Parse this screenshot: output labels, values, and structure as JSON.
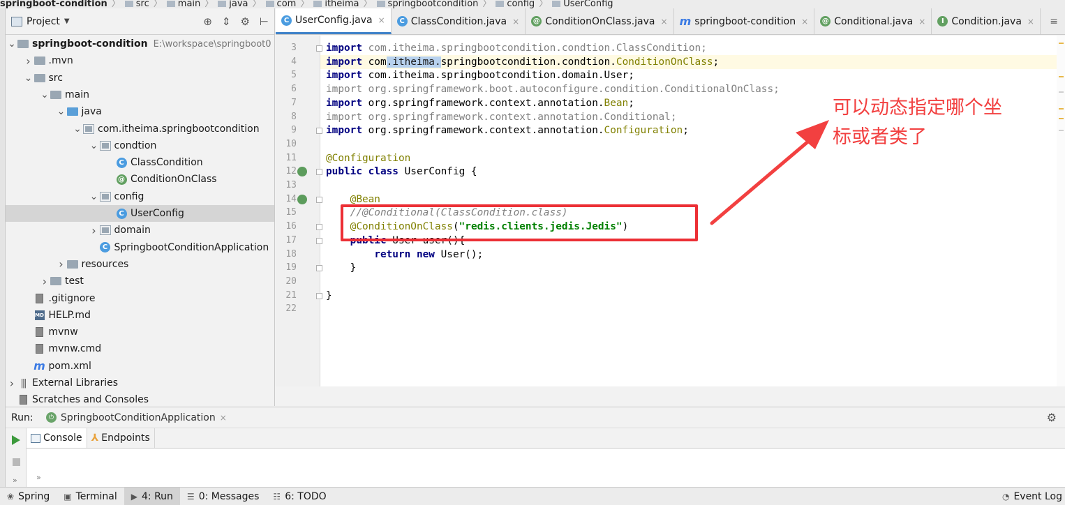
{
  "breadcrumb": [
    "springboot-condition",
    "src",
    "main",
    "java",
    "com",
    "itheima",
    "springbootcondition",
    "config",
    "UserConfig"
  ],
  "project_panel": {
    "title": "Project",
    "tree": [
      {
        "label": "springboot-condition",
        "path": "E:\\workspace\\springboot0",
        "level": 0,
        "expanded": true,
        "icon": "folder-icon",
        "bold": true
      },
      {
        "label": ".mvn",
        "level": 1,
        "expanded": false,
        "icon": "folder-icon"
      },
      {
        "label": "src",
        "level": 1,
        "expanded": true,
        "icon": "folder-icon"
      },
      {
        "label": "main",
        "level": 2,
        "expanded": true,
        "icon": "folder-icon"
      },
      {
        "label": "java",
        "level": 3,
        "expanded": true,
        "icon": "source-folder-icon"
      },
      {
        "label": "com.itheima.springbootcondition",
        "level": 4,
        "expanded": true,
        "icon": "package-icon"
      },
      {
        "label": "condtion",
        "level": 5,
        "expanded": true,
        "icon": "package-icon"
      },
      {
        "label": "ClassCondition",
        "level": 6,
        "icon": "class-icon"
      },
      {
        "label": "ConditionOnClass",
        "level": 6,
        "icon": "annotation-icon"
      },
      {
        "label": "config",
        "level": 5,
        "expanded": true,
        "icon": "package-icon"
      },
      {
        "label": "UserConfig",
        "level": 6,
        "icon": "class-icon",
        "selected": true
      },
      {
        "label": "domain",
        "level": 5,
        "expanded": false,
        "icon": "package-icon"
      },
      {
        "label": "SpringbootConditionApplication",
        "level": 5,
        "icon": "spring-boot-class-icon"
      },
      {
        "label": "resources",
        "level": 3,
        "expanded": false,
        "icon": "resources-folder-icon"
      },
      {
        "label": "test",
        "level": 2,
        "expanded": false,
        "icon": "folder-icon"
      },
      {
        "label": ".gitignore",
        "level": 1,
        "icon": "file-icon"
      },
      {
        "label": "HELP.md",
        "level": 1,
        "icon": "markdown-icon"
      },
      {
        "label": "mvnw",
        "level": 1,
        "icon": "file-icon"
      },
      {
        "label": "mvnw.cmd",
        "level": 1,
        "icon": "file-icon"
      },
      {
        "label": "pom.xml",
        "level": 1,
        "icon": "maven-icon"
      },
      {
        "label": "External Libraries",
        "level": 0,
        "expanded": false,
        "icon": "library-icon"
      },
      {
        "label": "Scratches and Consoles",
        "level": 0,
        "icon": "scratches-icon"
      }
    ]
  },
  "editor_tabs": [
    {
      "label": "UserConfig.java",
      "icon": "class-icon",
      "active": true
    },
    {
      "label": "ClassCondition.java",
      "icon": "class-icon"
    },
    {
      "label": "ConditionOnClass.java",
      "icon": "annotation-icon"
    },
    {
      "label": "springboot-condition",
      "icon": "maven-icon"
    },
    {
      "label": "Conditional.java",
      "icon": "annotation-icon"
    },
    {
      "label": "Condition.java",
      "icon": "interface-icon"
    }
  ],
  "code_lines": [
    {
      "n": "3",
      "tokens": [
        [
          "kw",
          "import"
        ],
        [
          "gray",
          " com.itheima.springbootcondition.condtion.ClassCondition;"
        ]
      ]
    },
    {
      "n": "4",
      "current": true,
      "tokens": [
        [
          "kw",
          "import"
        ],
        [
          "ident",
          " co"
        ],
        [
          "ident",
          "m"
        ],
        [
          "sel",
          ".itheima."
        ],
        [
          "ident",
          "springbootcondition.condtion."
        ],
        [
          "ann",
          "ConditionOnClass"
        ],
        [
          "ident",
          ";"
        ]
      ]
    },
    {
      "n": "5",
      "tokens": [
        [
          "kw",
          "import"
        ],
        [
          "ident",
          " com.itheima.springbootcondition.domain.User;"
        ]
      ]
    },
    {
      "n": "6",
      "tokens": [
        [
          "gray",
          "import org.springframework.boot.autoconfigure.condition.ConditionalOnClass;"
        ]
      ]
    },
    {
      "n": "7",
      "tokens": [
        [
          "kw",
          "import"
        ],
        [
          "ident",
          " org.springframework.context.annotation."
        ],
        [
          "ann",
          "Bean"
        ],
        [
          "ident",
          ";"
        ]
      ]
    },
    {
      "n": "8",
      "tokens": [
        [
          "gray",
          "import org.springframework.context.annotation.Conditional;"
        ]
      ]
    },
    {
      "n": "9",
      "tokens": [
        [
          "kw",
          "import"
        ],
        [
          "ident",
          " org.springframework.context.annotation."
        ],
        [
          "ann",
          "Configuration"
        ],
        [
          "ident",
          ";"
        ]
      ]
    },
    {
      "n": "10",
      "tokens": []
    },
    {
      "n": "11",
      "tokens": [
        [
          "ann",
          "@Configuration"
        ]
      ]
    },
    {
      "n": "12",
      "tokens": [
        [
          "kw",
          "public class"
        ],
        [
          "ident",
          " UserConfig {"
        ]
      ]
    },
    {
      "n": "13",
      "tokens": []
    },
    {
      "n": "14",
      "tokens": [
        [
          "ident",
          "    "
        ],
        [
          "ann",
          "@Bean"
        ]
      ]
    },
    {
      "n": "15",
      "tokens": [
        [
          "ident",
          "    "
        ],
        [
          "cmt",
          "//@Conditional(ClassCondition.class)"
        ]
      ]
    },
    {
      "n": "16",
      "tokens": [
        [
          "ident",
          "    "
        ],
        [
          "ann",
          "@ConditionOnClass"
        ],
        [
          "ident",
          "("
        ],
        [
          "str",
          "\"redis.clients.jedis.Jedis\""
        ],
        [
          "ident",
          ")"
        ]
      ]
    },
    {
      "n": "17",
      "tokens": [
        [
          "ident",
          "    "
        ],
        [
          "kw",
          "public"
        ],
        [
          "ident",
          " User user(){"
        ]
      ]
    },
    {
      "n": "18",
      "tokens": [
        [
          "ident",
          "        "
        ],
        [
          "kw",
          "return new"
        ],
        [
          "ident",
          " User();"
        ]
      ]
    },
    {
      "n": "19",
      "tokens": [
        [
          "ident",
          "    }"
        ]
      ]
    },
    {
      "n": "20",
      "tokens": []
    },
    {
      "n": "21",
      "tokens": [
        [
          "ident",
          "}"
        ]
      ]
    },
    {
      "n": "22",
      "tokens": []
    }
  ],
  "annotation": {
    "text": "可以动态指定哪个坐标或者类了",
    "color": "#f24040"
  },
  "run_panel": {
    "label": "Run:",
    "config": "SpringbootConditionApplication",
    "tabs": [
      "Console",
      "Endpoints"
    ]
  },
  "bottom_bar": [
    {
      "label": "Spring",
      "icon": "spring-icon"
    },
    {
      "label": "Terminal",
      "icon": "terminal-icon"
    },
    {
      "label": "4: Run",
      "icon": "run-icon",
      "active": true
    },
    {
      "label": "0: Messages",
      "icon": "messages-icon"
    },
    {
      "label": "6: TODO",
      "icon": "todo-icon"
    },
    {
      "label": "Event Log",
      "icon": "event-log-icon"
    }
  ],
  "colors": {
    "accent": "#4083c9",
    "highlight_box": "#ec2f35",
    "keyword": "#000080",
    "annotation": "#808000",
    "string": "#008000"
  }
}
